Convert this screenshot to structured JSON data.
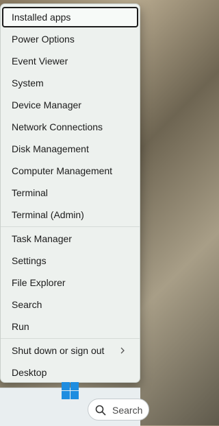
{
  "menu": {
    "items": [
      {
        "label": "Installed apps"
      },
      {
        "label": "Power Options"
      },
      {
        "label": "Event Viewer"
      },
      {
        "label": "System"
      },
      {
        "label": "Device Manager"
      },
      {
        "label": "Network Connections"
      },
      {
        "label": "Disk Management"
      },
      {
        "label": "Computer Management"
      },
      {
        "label": "Terminal"
      },
      {
        "label": "Terminal (Admin)"
      },
      {
        "label": "Task Manager"
      },
      {
        "label": "Settings"
      },
      {
        "label": "File Explorer"
      },
      {
        "label": "Search"
      },
      {
        "label": "Run"
      },
      {
        "label": "Shut down or sign out"
      },
      {
        "label": "Desktop"
      }
    ]
  },
  "taskbar": {
    "search_label": "Search",
    "start_icon": "windows-logo-icon",
    "accent": "#1e8de0"
  }
}
